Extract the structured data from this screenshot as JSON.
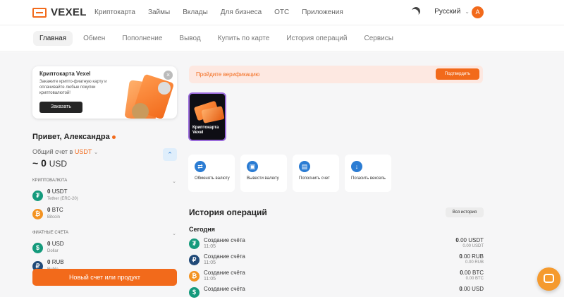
{
  "header": {
    "brand": "VEXEL",
    "nav": [
      "Криптокарта",
      "Займы",
      "Вклады",
      "Для бизнеса",
      "OTC",
      "Приложения"
    ],
    "language": "Русский",
    "avatar_letter": "A"
  },
  "subnav": {
    "tabs": [
      "Главная",
      "Обмен",
      "Пополнение",
      "Вывод",
      "Купить по карте",
      "История операций",
      "Сервисы"
    ],
    "active": "Главная"
  },
  "promo": {
    "title": "Криптокарта Vexel",
    "text": "Закажите крипто-фиатную карту и оплачивайте любые покупки криптовалютой!",
    "button": "Заказать",
    "close": "×"
  },
  "account": {
    "greeting": "Привет, Александра",
    "total_label": "Общий счет в",
    "currency": "USDT",
    "total_prefix": "~",
    "total_value": "0",
    "total_unit": "USD",
    "collapse_glyph": "⌃"
  },
  "crypto_section": {
    "title": "КРИПТОВАЛЮТА",
    "items": [
      {
        "amount": "0",
        "code": "USDT",
        "name": "Tether (ERC-20)",
        "glyph": "₮"
      },
      {
        "amount": "0",
        "code": "BTC",
        "name": "Bitcoin",
        "glyph": "₿"
      }
    ]
  },
  "fiat_section": {
    "title": "ФИАТНЫЕ СЧЕТА",
    "items": [
      {
        "amount": "0",
        "code": "USD",
        "name": "Dollar",
        "glyph": "$"
      },
      {
        "amount": "0",
        "code": "RUB",
        "name": "Ruble",
        "glyph": "₽"
      }
    ]
  },
  "new_account_button": "Новый счет или продукт",
  "verification": {
    "text": "Пройдите верификацию",
    "button": "Подтвердить"
  },
  "story": {
    "label": "Криптокарта Vexel"
  },
  "actions": [
    {
      "label": "Обменять валюту",
      "icon": "⇄"
    },
    {
      "label": "Вывести валюту",
      "icon": "▣"
    },
    {
      "label": "Пополнить счет",
      "icon": "▤"
    },
    {
      "label": "Погасить вексель",
      "icon": "↓"
    }
  ],
  "history": {
    "title": "История операций",
    "all_button": "Вся история",
    "today": "Сегодня",
    "ops": [
      {
        "title": "Создание счёта",
        "time": "11:05",
        "int": "0",
        "frac": ".00 USDT",
        "sub": "0.00 USDT",
        "glyph": "₮"
      },
      {
        "title": "Создание счёта",
        "time": "11:05",
        "int": "0",
        "frac": ".00 RUB",
        "sub": "0.00 RUB",
        "glyph": "₽"
      },
      {
        "title": "Создание счёта",
        "time": "11:05",
        "int": "0",
        "frac": ".00 BTC",
        "sub": "0.00 BTC",
        "glyph": "₿"
      },
      {
        "title": "Создание счёта",
        "time": "",
        "int": "0",
        "frac": ".00 USD",
        "sub": "",
        "glyph": "$"
      }
    ]
  },
  "colors": {
    "accent": "#f26a1b",
    "blue": "#2b7cd3",
    "tether": "#149a7c",
    "btc": "#f39322",
    "rub": "#214a78"
  }
}
